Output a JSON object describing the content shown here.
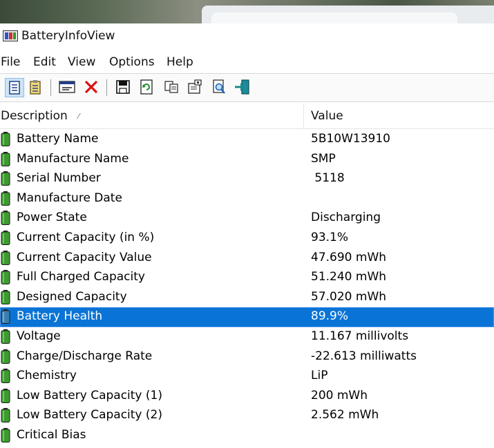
{
  "window": {
    "title": "BatteryInfoView"
  },
  "menu": [
    {
      "label": "File"
    },
    {
      "label": "Edit"
    },
    {
      "label": "View"
    },
    {
      "label": "Options"
    },
    {
      "label": "Help"
    }
  ],
  "toolbar": {
    "buttons": [
      {
        "icon": "html-report-icon"
      },
      {
        "icon": "list-view-icon"
      },
      {
        "icon": "battery-window-icon"
      },
      {
        "icon": "delete-icon"
      },
      {
        "icon": "save-icon"
      },
      {
        "icon": "refresh-icon"
      },
      {
        "icon": "copy-icon"
      },
      {
        "icon": "properties-icon"
      },
      {
        "icon": "find-icon"
      },
      {
        "icon": "exit-icon"
      }
    ]
  },
  "table": {
    "columns": {
      "description": "Description",
      "value": "Value"
    },
    "selected_index": 9,
    "rows": [
      {
        "description": "Battery Name",
        "value": "5B10W13910"
      },
      {
        "description": "Manufacture Name",
        "value": "SMP"
      },
      {
        "description": "Serial Number",
        "value": " 5118"
      },
      {
        "description": "Manufacture Date",
        "value": ""
      },
      {
        "description": "Power State",
        "value": "Discharging"
      },
      {
        "description": "Current Capacity (in %)",
        "value": "93.1%"
      },
      {
        "description": "Current Capacity Value",
        "value": "47.690 mWh"
      },
      {
        "description": "Full Charged Capacity",
        "value": "51.240 mWh"
      },
      {
        "description": "Designed Capacity",
        "value": "57.020 mWh"
      },
      {
        "description": "Battery Health",
        "value": "89.9%"
      },
      {
        "description": "Voltage",
        "value": "11.167 millivolts"
      },
      {
        "description": "Charge/Discharge Rate",
        "value": "-22.613 milliwatts"
      },
      {
        "description": "Chemistry",
        "value": "LiP"
      },
      {
        "description": "Low Battery Capacity (1)",
        "value": "200 mWh"
      },
      {
        "description": "Low Battery Capacity (2)",
        "value": "2.562 mWh"
      },
      {
        "description": "Critical Bias",
        "value": ""
      }
    ]
  },
  "colors": {
    "selection": "#0a74d6",
    "battery_green": "#3d9b2f"
  }
}
